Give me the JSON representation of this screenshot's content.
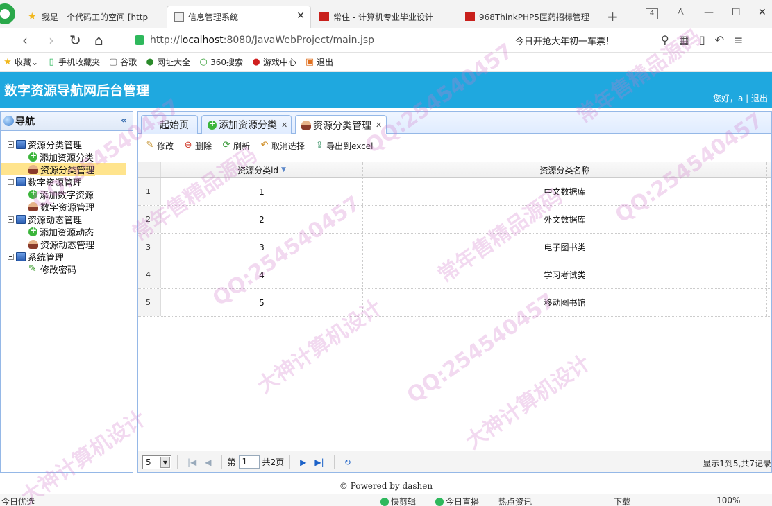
{
  "browser": {
    "tabs": [
      {
        "label": "我是一个代码工的空间 [http",
        "active": false
      },
      {
        "label": "信息管理系统",
        "active": true
      },
      {
        "label": "常住 - 计算机专业毕业设计",
        "active": false
      },
      {
        "label": "968ThinkPHP5医药招标管理",
        "active": false
      }
    ],
    "tab_count": "4",
    "url_prefix": "http://",
    "url_host": "localhost",
    "url_rest": ":8080/JavaWebProject/main.jsp",
    "promo_text": "今日开抢大年初一车票！",
    "bookmarks": [
      "收藏",
      "手机收藏夹",
      "谷歌",
      "网址大全",
      "360搜索",
      "游戏中心",
      "退出"
    ],
    "status_left": "今日优选",
    "status_right": [
      "快剪辑",
      "今日直播",
      "热点资讯",
      "下载",
      "100%"
    ]
  },
  "app": {
    "title": "数字资源导航网后台管理",
    "greeting": "您好，a | 退出",
    "footer": "© Powered by dashen"
  },
  "nav": {
    "title": "导航",
    "collapse_symbol": "«",
    "groups": [
      {
        "label": "资源分类管理",
        "items": [
          "添加资源分类",
          "资源分类管理"
        ]
      },
      {
        "label": "数字资源管理",
        "items": [
          "添加数字资源",
          "数字资源管理"
        ]
      },
      {
        "label": "资源动态管理",
        "items": [
          "添加资源动态",
          "资源动态管理"
        ]
      },
      {
        "label": "系统管理",
        "items": [
          "修改密码"
        ]
      }
    ]
  },
  "tabs": [
    {
      "label": "起始页",
      "closable": false
    },
    {
      "label": "添加资源分类",
      "closable": true
    },
    {
      "label": "资源分类管理",
      "closable": true,
      "active": true
    }
  ],
  "toolbar": {
    "edit": "修改",
    "delete": "删除",
    "refresh": "刷新",
    "unselect": "取消选择",
    "export": "导出到excel"
  },
  "grid": {
    "columns": [
      "资源分类id",
      "资源分类名称"
    ],
    "rows": [
      {
        "num": "1",
        "id": "1",
        "name": "中文数据库"
      },
      {
        "num": "2",
        "id": "2",
        "name": "外文数据库"
      },
      {
        "num": "3",
        "id": "3",
        "name": "电子图书类"
      },
      {
        "num": "4",
        "id": "4",
        "name": "学习考试类"
      },
      {
        "num": "5",
        "id": "5",
        "name": "移动图书馆"
      }
    ]
  },
  "pager": {
    "page_size": "5",
    "page_prefix": "第",
    "page_current": "1",
    "page_total": "共2页",
    "info": "显示1到5,共7记录"
  },
  "watermarks": [
    "QQ:254540457",
    "常年售精品源码",
    "大神计算机设计"
  ],
  "colors": {
    "header": "#1fa8df",
    "panel_border": "#95b8e7",
    "selected": "#ffe48d"
  }
}
